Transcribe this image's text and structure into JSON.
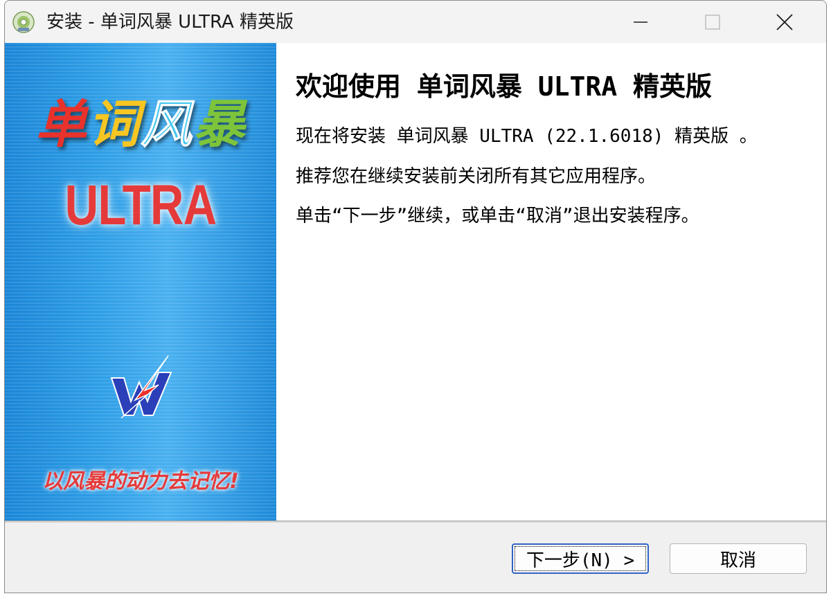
{
  "window": {
    "title": "安装 - 单词风暴 ULTRA 精英版",
    "icon": "setup-disc-icon"
  },
  "titlebar_buttons": {
    "minimize_icon": "minimize-icon",
    "maximize_icon": "maximize-icon",
    "close_icon": "close-icon"
  },
  "banner": {
    "brand_chars": [
      "单",
      "词",
      "风",
      "暴"
    ],
    "product": "ULTRA",
    "slogan": "以风暴的动力去记忆!",
    "logo_icon": "ww-lightning-logo-icon"
  },
  "content": {
    "heading": "欢迎使用 单词风暴 ULTRA 精英版",
    "line1": "现在将安装 单词风暴 ULTRA (22.1.6018) 精英版 。",
    "line2": "推荐您在继续安装前关闭所有其它应用程序。",
    "line3": "单击“下一步”继续，或单击“取消”退出安装程序。"
  },
  "buttons": {
    "next_label": "下一步(N) >",
    "cancel_label": "取消"
  },
  "colors": {
    "banner_blue": "#2e9ee6",
    "accent_red": "#e53a3a",
    "focus_border": "#2f63c4"
  }
}
